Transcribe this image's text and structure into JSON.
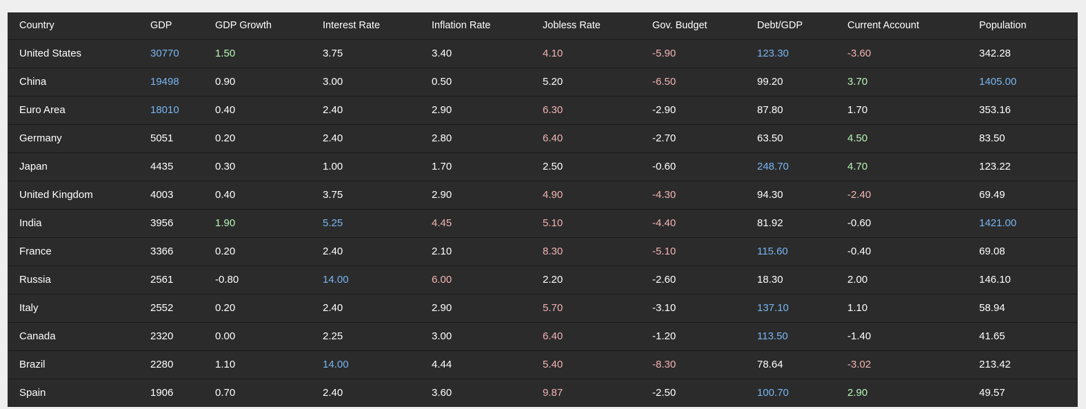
{
  "table": {
    "headers": [
      "Country",
      "GDP",
      "GDP Growth",
      "Interest Rate",
      "Inflation Rate",
      "Jobless Rate",
      "Gov. Budget",
      "Debt/GDP",
      "Current Account",
      "Population"
    ],
    "rows": [
      [
        "United States",
        "30770",
        "1.50",
        "3.75",
        "3.40",
        "4.10",
        "-5.90",
        "123.30",
        "-3.60",
        "342.28"
      ],
      [
        "China",
        "19498",
        "0.90",
        "3.00",
        "0.50",
        "5.20",
        "-6.50",
        "99.20",
        "3.70",
        "1405.00"
      ],
      [
        "Euro Area",
        "18010",
        "0.40",
        "2.40",
        "2.90",
        "6.30",
        "-2.90",
        "87.80",
        "1.70",
        "353.16"
      ],
      [
        "Germany",
        "5051",
        "0.20",
        "2.40",
        "2.80",
        "6.40",
        "-2.70",
        "63.50",
        "4.50",
        "83.50"
      ],
      [
        "Japan",
        "4435",
        "0.30",
        "1.00",
        "1.70",
        "2.50",
        "-0.60",
        "248.70",
        "4.70",
        "123.22"
      ],
      [
        "United Kingdom",
        "4003",
        "0.40",
        "3.75",
        "2.90",
        "4.90",
        "-4.30",
        "94.30",
        "-2.40",
        "69.49"
      ],
      [
        "India",
        "3956",
        "1.90",
        "5.25",
        "4.45",
        "5.10",
        "-4.40",
        "81.92",
        "-0.60",
        "1421.00"
      ],
      [
        "France",
        "3366",
        "0.20",
        "2.40",
        "2.10",
        "8.30",
        "-5.10",
        "115.60",
        "-0.40",
        "69.08"
      ],
      [
        "Russia",
        "2561",
        "-0.80",
        "14.00",
        "6.00",
        "2.20",
        "-2.60",
        "18.30",
        "2.00",
        "146.10"
      ],
      [
        "Italy",
        "2552",
        "0.20",
        "2.40",
        "2.90",
        "5.70",
        "-3.10",
        "137.10",
        "1.10",
        "58.94"
      ],
      [
        "Canada",
        "2320",
        "0.00",
        "2.25",
        "3.00",
        "6.40",
        "-1.20",
        "113.50",
        "-1.40",
        "41.65"
      ],
      [
        "Brazil",
        "2280",
        "1.10",
        "14.00",
        "4.44",
        "5.40",
        "-8.30",
        "78.64",
        "-3.02",
        "213.42"
      ],
      [
        "Spain",
        "1906",
        "0.70",
        "2.40",
        "3.60",
        "9.87",
        "-2.50",
        "100.70",
        "2.90",
        "49.57"
      ]
    ],
    "tones": [
      [
        "n",
        "hi",
        "pos",
        "n",
        "n",
        "neg",
        "neg",
        "hi",
        "neg",
        "n"
      ],
      [
        "n",
        "hi",
        "n",
        "n",
        "n",
        "n",
        "neg",
        "n",
        "pos",
        "hi"
      ],
      [
        "n",
        "hi",
        "n",
        "n",
        "n",
        "neg",
        "n",
        "n",
        "n",
        "n"
      ],
      [
        "n",
        "n",
        "n",
        "n",
        "n",
        "neg",
        "n",
        "n",
        "pos",
        "n"
      ],
      [
        "n",
        "n",
        "n",
        "n",
        "n",
        "n",
        "n",
        "hi",
        "pos",
        "n"
      ],
      [
        "n",
        "n",
        "n",
        "n",
        "n",
        "neg",
        "neg",
        "n",
        "neg",
        "n"
      ],
      [
        "n",
        "n",
        "pos",
        "hi",
        "neg",
        "neg",
        "neg",
        "n",
        "n",
        "hi"
      ],
      [
        "n",
        "n",
        "n",
        "n",
        "n",
        "neg",
        "neg",
        "hi",
        "n",
        "n"
      ],
      [
        "n",
        "n",
        "n",
        "hi",
        "neg",
        "n",
        "n",
        "n",
        "n",
        "n"
      ],
      [
        "n",
        "n",
        "n",
        "n",
        "n",
        "neg",
        "n",
        "hi",
        "n",
        "n"
      ],
      [
        "n",
        "n",
        "n",
        "n",
        "n",
        "neg",
        "n",
        "hi",
        "n",
        "n"
      ],
      [
        "n",
        "n",
        "n",
        "hi",
        "n",
        "neg",
        "neg",
        "n",
        "neg",
        "n"
      ],
      [
        "n",
        "n",
        "n",
        "n",
        "n",
        "neg",
        "n",
        "hi",
        "pos",
        "n"
      ]
    ]
  },
  "colors": {
    "background": "#2b2b2b",
    "text": "#ffffff",
    "highlight_blue": "#79b6f2",
    "positive_green": "#b9f6b9",
    "negative_red": "#f4b4b4"
  }
}
